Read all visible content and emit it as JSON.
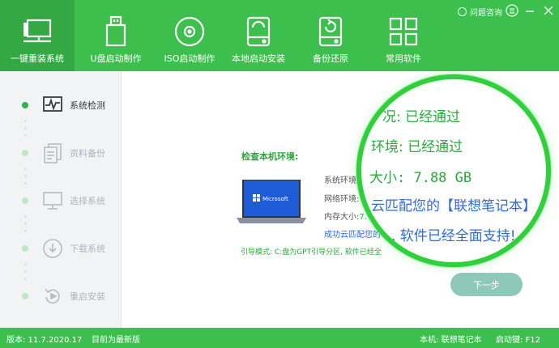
{
  "header": {
    "help_label": "问题咨询",
    "tabs": [
      {
        "label": "一键重装系统",
        "icon": "monitor-icon",
        "active": true
      },
      {
        "label": "U盘启动制作",
        "icon": "usb-drive-icon",
        "active": false
      },
      {
        "label": "ISO启动制作",
        "icon": "disc-icon",
        "active": false
      },
      {
        "label": "本地启动安装",
        "icon": "hard-drive-icon",
        "active": false
      },
      {
        "label": "备份还原",
        "icon": "backup-restore-icon",
        "active": false
      },
      {
        "label": "常用软件",
        "icon": "grid-apps-icon",
        "active": false
      }
    ]
  },
  "steps": [
    {
      "label": "系统检测",
      "icon": "pulse-monitor-icon",
      "active": true
    },
    {
      "label": "资料备份",
      "icon": "document-copy-icon",
      "active": false
    },
    {
      "label": "选择系统",
      "icon": "monitor-select-icon",
      "active": false
    },
    {
      "label": "下载系统",
      "icon": "download-icon",
      "active": false
    },
    {
      "label": "重启安装",
      "icon": "restart-icon",
      "active": false
    }
  ],
  "main": {
    "title": "检查本机环境:",
    "laptop_logo_text": "Microsoft",
    "rows": [
      {
        "label": "系统环境:",
        "value": ""
      },
      {
        "label": "网络环境:",
        "value": ""
      },
      {
        "label": "内存大小:",
        "value": "7."
      }
    ],
    "match_text": "成功云匹配您的",
    "guide_text": "引导模式: C:盘为GPT引导分区, 软件已经全"
  },
  "magnifier": {
    "line1": "况: 已经通过",
    "line2": "环境: 已经通过",
    "line3": "大小: 7.88 GB",
    "line4": "云匹配您的【联想笔记本】",
    "line5": "】, 软件已经全面支持!"
  },
  "next_button": "下一步",
  "status": {
    "version": "版本: 11.7.2020.17",
    "latest": "目前为最新版",
    "machine": "本机: 联想笔记本",
    "hotkey": "启动键: F12"
  },
  "colors": {
    "brand_green": "#3cbf4c",
    "text_green": "#2aa83d",
    "link_blue": "#2f6ad6"
  }
}
